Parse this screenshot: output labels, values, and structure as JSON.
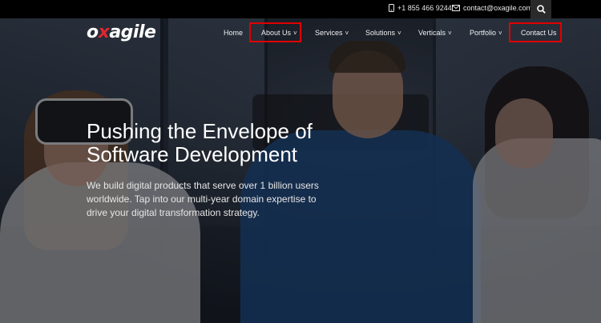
{
  "topbar": {
    "phone": "+1 855 466 9244",
    "email": "contact@oxagile.com",
    "phone_icon": "phone-icon",
    "email_icon": "envelope-icon",
    "search_icon": "search-icon"
  },
  "brand": {
    "logo_prefix": "o",
    "logo_x": "x",
    "logo_suffix": "agile",
    "accent_color": "#e0262e"
  },
  "nav": {
    "items": [
      {
        "label": "Home",
        "has_dropdown": false
      },
      {
        "label": "About Us",
        "has_dropdown": true
      },
      {
        "label": "Services",
        "has_dropdown": true
      },
      {
        "label": "Solutions",
        "has_dropdown": true
      },
      {
        "label": "Verticals",
        "has_dropdown": true
      },
      {
        "label": "Portfolio",
        "has_dropdown": true
      },
      {
        "label": "Contact Us",
        "has_dropdown": false
      }
    ],
    "chevron": "˅",
    "highlight_color": "#e00000"
  },
  "hero": {
    "headline_line1": "Pushing the Envelope of",
    "headline_line2": "Software Development",
    "subtext": "We build digital products that serve over 1 billion users worldwide. Tap into our multi-year domain expertise to drive your digital transformation strategy."
  }
}
